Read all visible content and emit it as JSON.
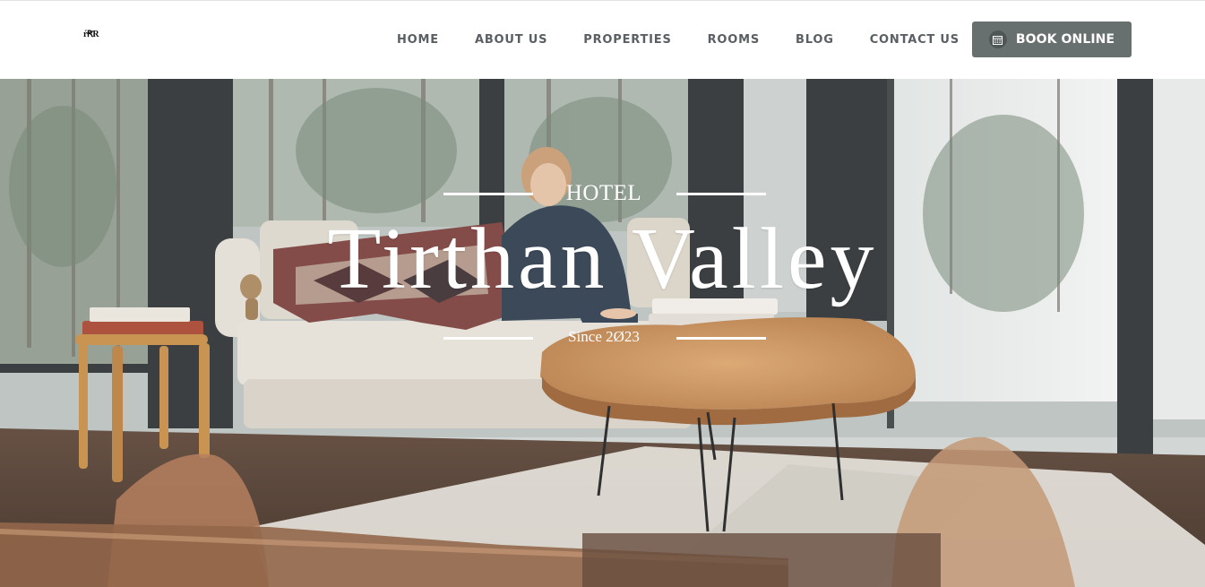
{
  "brand": {
    "logo_text": "ŕꞦR"
  },
  "nav": {
    "items": [
      {
        "id": "home",
        "label": "HOME"
      },
      {
        "id": "about",
        "label": "ABOUT US"
      },
      {
        "id": "properties",
        "label": "PROPERTIES"
      },
      {
        "id": "rooms",
        "label": "ROOMS"
      },
      {
        "id": "blog",
        "label": "BLOG"
      },
      {
        "id": "contact",
        "label": "CONTACT US"
      }
    ],
    "book_label": "BOOK ONLINE",
    "book_icon": "calendar-icon"
  },
  "hero": {
    "eyebrow": "HOTEL",
    "title": "Tirthan Valley",
    "tagline": "Since 2Ø23"
  },
  "colors": {
    "nav_text": "#595f62",
    "button_bg": "#68706f",
    "hero_text": "#ffffff"
  }
}
